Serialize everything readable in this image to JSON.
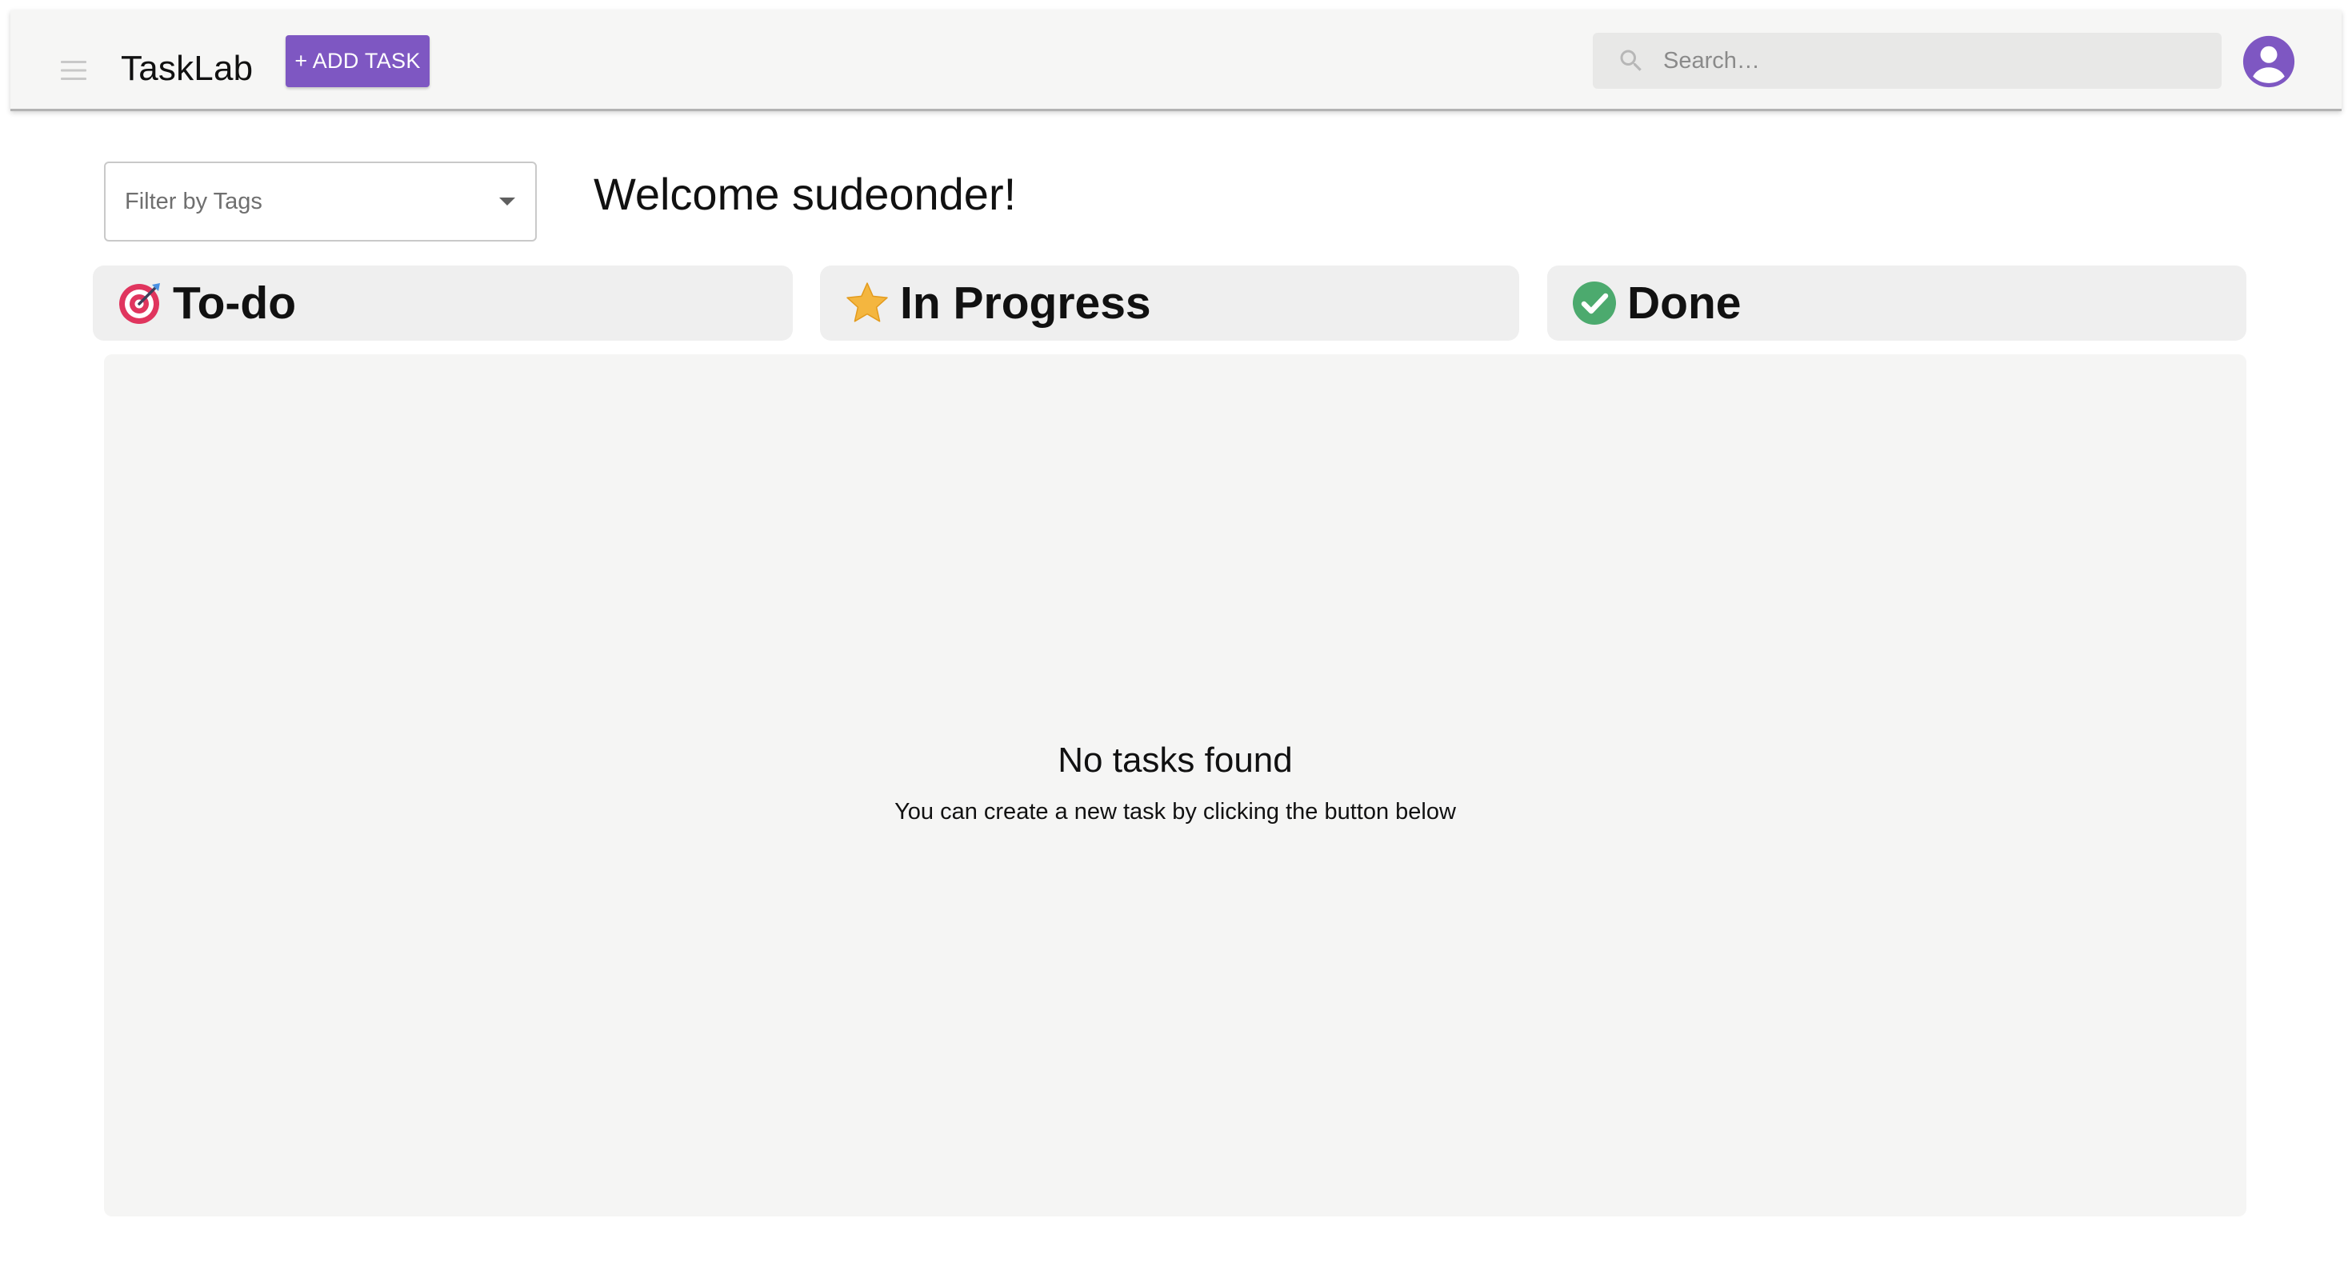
{
  "app": {
    "title": "TaskLab",
    "add_task_label": "+ ADD TASK",
    "accent_color": "#7e57c2"
  },
  "search": {
    "placeholder": "Search…",
    "value": ""
  },
  "filter": {
    "placeholder": "Filter by Tags"
  },
  "welcome": {
    "text": "Welcome sudeonder!"
  },
  "columns": [
    {
      "title": "To-do",
      "icon": "target-icon"
    },
    {
      "title": "In Progress",
      "icon": "star-icon"
    },
    {
      "title": "Done",
      "icon": "check-circle-icon"
    }
  ],
  "empty_state": {
    "title": "No tasks found",
    "subtitle": "You can create a new task by clicking the button below"
  },
  "icons": {
    "menu": "menu-icon",
    "search": "search-icon",
    "avatar": "account-circle-icon",
    "dropdown": "caret-down-icon"
  }
}
